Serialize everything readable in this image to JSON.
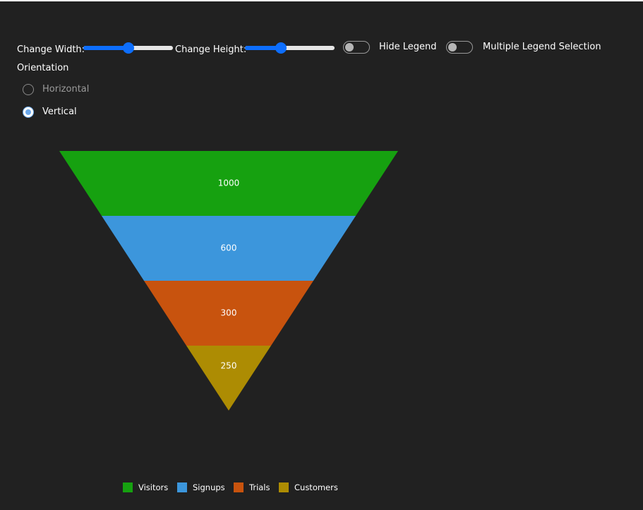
{
  "controls": {
    "change_width_label": "Change Width:",
    "change_height_label": "Change Height:",
    "width_slider_value": 0.5,
    "height_slider_value": 0.4,
    "hide_legend_label": "Hide Legend",
    "hide_legend_on": false,
    "multiple_legend_label": "Multiple Legend Selection",
    "multiple_legend_on": false
  },
  "orientation": {
    "label": "Orientation",
    "options": [
      {
        "label": "Horizontal",
        "selected": false
      },
      {
        "label": "Vertical",
        "selected": true
      }
    ]
  },
  "chart_data": {
    "type": "funnel",
    "orientation": "vertical",
    "categories": [
      "Visitors",
      "Signups",
      "Trials",
      "Customers"
    ],
    "values": [
      1000,
      600,
      300,
      250
    ],
    "colors": [
      "#16a110",
      "#3c96dc",
      "#c8530e",
      "#ad8c03"
    ],
    "legend": {
      "visible": true,
      "placement": "bottom"
    }
  }
}
